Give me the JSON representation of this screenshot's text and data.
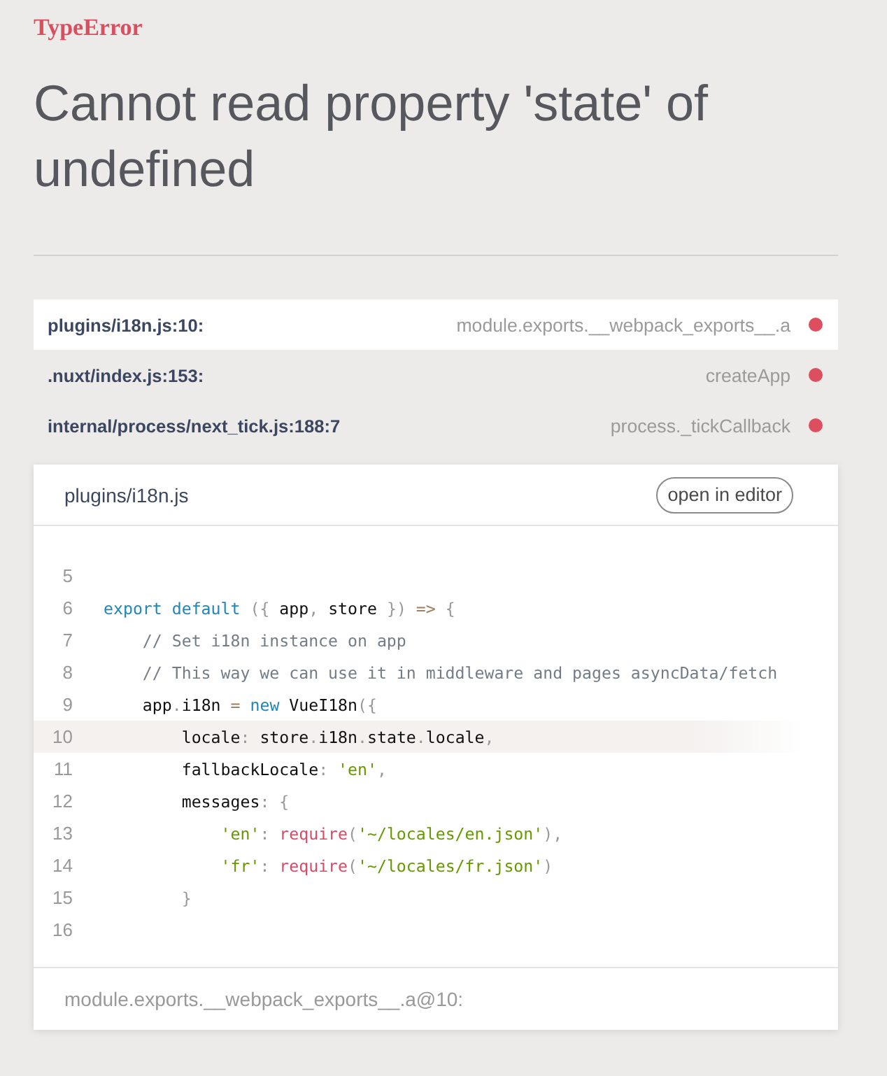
{
  "error": {
    "type": "TypeError",
    "message": "Cannot read property 'state' of undefined"
  },
  "frames": [
    {
      "location": "plugins/i18n.js:10:",
      "function": "module.exports.__webpack_exports__.a",
      "selected": true
    },
    {
      "location": ".nuxt/index.js:153:",
      "function": "createApp",
      "selected": false
    },
    {
      "location": "internal/process/next_tick.js:188:7",
      "function": "process._tickCallback",
      "selected": false
    }
  ],
  "code_card": {
    "file": "plugins/i18n.js",
    "button": "open in editor",
    "lines": [
      {
        "number": "5",
        "selected": false
      },
      {
        "number": "6",
        "selected": false,
        "tokens": [
          {
            "kind": "keyword",
            "text": "export"
          },
          {
            "kind": "keyword",
            "text": " default"
          },
          {
            "kind": "punct",
            "text": " ({"
          },
          {
            "kind": "plain",
            "text": " app"
          },
          {
            "kind": "punct",
            "text": ","
          },
          {
            "kind": "plain",
            "text": " store "
          },
          {
            "kind": "punct",
            "text": "})"
          },
          {
            "kind": "operator",
            "text": " =>"
          },
          {
            "kind": "punct",
            "text": " {"
          }
        ]
      },
      {
        "number": "7",
        "selected": false,
        "tokens": [
          {
            "kind": "comment",
            "text": "    // Set i18n instance on app"
          }
        ]
      },
      {
        "number": "8",
        "selected": false,
        "tokens": [
          {
            "kind": "comment",
            "text": "    // This way we can use it in middleware and pages asyncData/fetch"
          }
        ]
      },
      {
        "number": "9",
        "selected": false,
        "tokens": [
          {
            "kind": "plain",
            "text": "    app"
          },
          {
            "kind": "punct",
            "text": "."
          },
          {
            "kind": "plain",
            "text": "i18n "
          },
          {
            "kind": "operator",
            "text": "="
          },
          {
            "kind": "keyword",
            "text": " new"
          },
          {
            "kind": "plain",
            "text": " VueI18n"
          },
          {
            "kind": "punct",
            "text": "({"
          }
        ]
      },
      {
        "number": "10",
        "selected": true,
        "tokens": [
          {
            "kind": "plain",
            "text": "        locale"
          },
          {
            "kind": "punct",
            "text": ":"
          },
          {
            "kind": "plain",
            "text": " store"
          },
          {
            "kind": "punct",
            "text": "."
          },
          {
            "kind": "plain",
            "text": "i18n"
          },
          {
            "kind": "punct",
            "text": "."
          },
          {
            "kind": "plain",
            "text": "state"
          },
          {
            "kind": "punct",
            "text": "."
          },
          {
            "kind": "plain",
            "text": "locale"
          },
          {
            "kind": "punct",
            "text": ","
          }
        ]
      },
      {
        "number": "11",
        "selected": false,
        "tokens": [
          {
            "kind": "plain",
            "text": "        fallbackLocale"
          },
          {
            "kind": "punct",
            "text": ":"
          },
          {
            "kind": "string",
            "text": " 'en'"
          },
          {
            "kind": "punct",
            "text": ","
          }
        ]
      },
      {
        "number": "12",
        "selected": false,
        "tokens": [
          {
            "kind": "plain",
            "text": "        messages"
          },
          {
            "kind": "punct",
            "text": ": {"
          }
        ]
      },
      {
        "number": "13",
        "selected": false,
        "tokens": [
          {
            "kind": "string",
            "text": "            'en'"
          },
          {
            "kind": "punct",
            "text": ":"
          },
          {
            "kind": "function",
            "text": " require"
          },
          {
            "kind": "punct",
            "text": "("
          },
          {
            "kind": "string",
            "text": "'~/locales/en.json'"
          },
          {
            "kind": "punct",
            "text": "),"
          }
        ]
      },
      {
        "number": "14",
        "selected": false,
        "tokens": [
          {
            "kind": "string",
            "text": "            'fr'"
          },
          {
            "kind": "punct",
            "text": ":"
          },
          {
            "kind": "function",
            "text": " require"
          },
          {
            "kind": "punct",
            "text": "("
          },
          {
            "kind": "string",
            "text": "'~/locales/fr.json'"
          },
          {
            "kind": "punct",
            "text": ")"
          }
        ]
      },
      {
        "number": "15",
        "selected": false,
        "tokens": [
          {
            "kind": "punct",
            "text": "        }"
          }
        ]
      },
      {
        "number": "16",
        "selected": false
      }
    ],
    "footer": "module.exports.__webpack_exports__.a@10:"
  }
}
